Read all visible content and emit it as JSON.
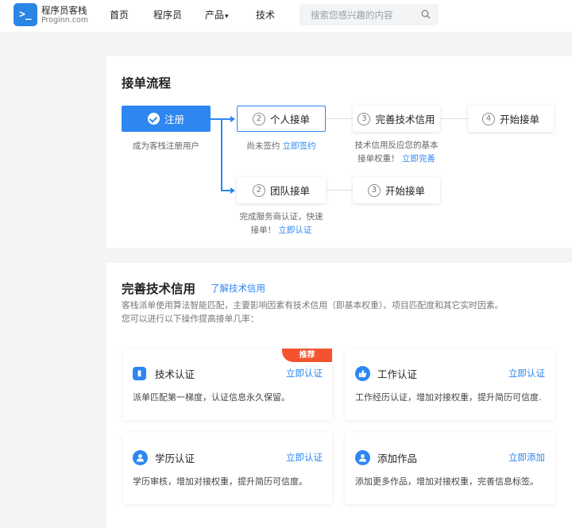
{
  "header": {
    "logo_glyph": ">_",
    "logo_title": "程序员客栈",
    "logo_sub": "Proginn.com",
    "nav": {
      "home": "首页",
      "programmers": "程序员",
      "products": "产品",
      "tech": "技术"
    },
    "search_placeholder": "搜索您感兴趣的内容"
  },
  "flow": {
    "title": "接单流程",
    "register": {
      "label": "注册",
      "desc": "成为客栈注册用户"
    },
    "personal": {
      "num": "2",
      "label": "个人接单",
      "desc_prefix": "尚未签约",
      "desc_link": "立即签约"
    },
    "credit": {
      "num": "3",
      "label": "完善技术信用",
      "desc_line1": "技术信用反应您的基本",
      "desc_line2": "接单权重！",
      "desc_link": "立即完善"
    },
    "start1": {
      "num": "4",
      "label": "开始接单"
    },
    "team": {
      "num": "2",
      "label": "团队接单",
      "desc_line1": "完成服务商认证，快速",
      "desc_line2": "接单！",
      "desc_link": "立即认证"
    },
    "start2": {
      "num": "3",
      "label": "开始接单"
    }
  },
  "credit_section": {
    "title": "完善技术信用",
    "learn_link": "了解技术信用",
    "intro_line1": "客栈派单使用算法智能匹配，主要影响因素有技术信用（即基本权重）、项目匹配度和其它实时因素。",
    "intro_line2": "您可以进行以下操作提高接单几率：",
    "items": [
      {
        "title": "技术认证",
        "action": "立即认证",
        "desc": "派单匹配第一梯度，认证信息永久保留。",
        "badge": "推荐",
        "icon": "badge-icon"
      },
      {
        "title": "工作认证",
        "action": "立即认证",
        "desc": "工作经历认证，增加对接权重，提升简历可信度.",
        "icon": "thumbs-up-icon"
      },
      {
        "title": "学历认证",
        "action": "立即认证",
        "desc": "学历审核，增加对接权重，提升简历可信度。",
        "icon": "user-icon"
      },
      {
        "title": "添加作品",
        "action": "立即添加",
        "desc": "添加更多作品，增加对接权重，完善信息标签。",
        "icon": "user-icon"
      }
    ]
  },
  "colors": {
    "accent": "#2e86f0",
    "ribbon": "#f4532d"
  }
}
